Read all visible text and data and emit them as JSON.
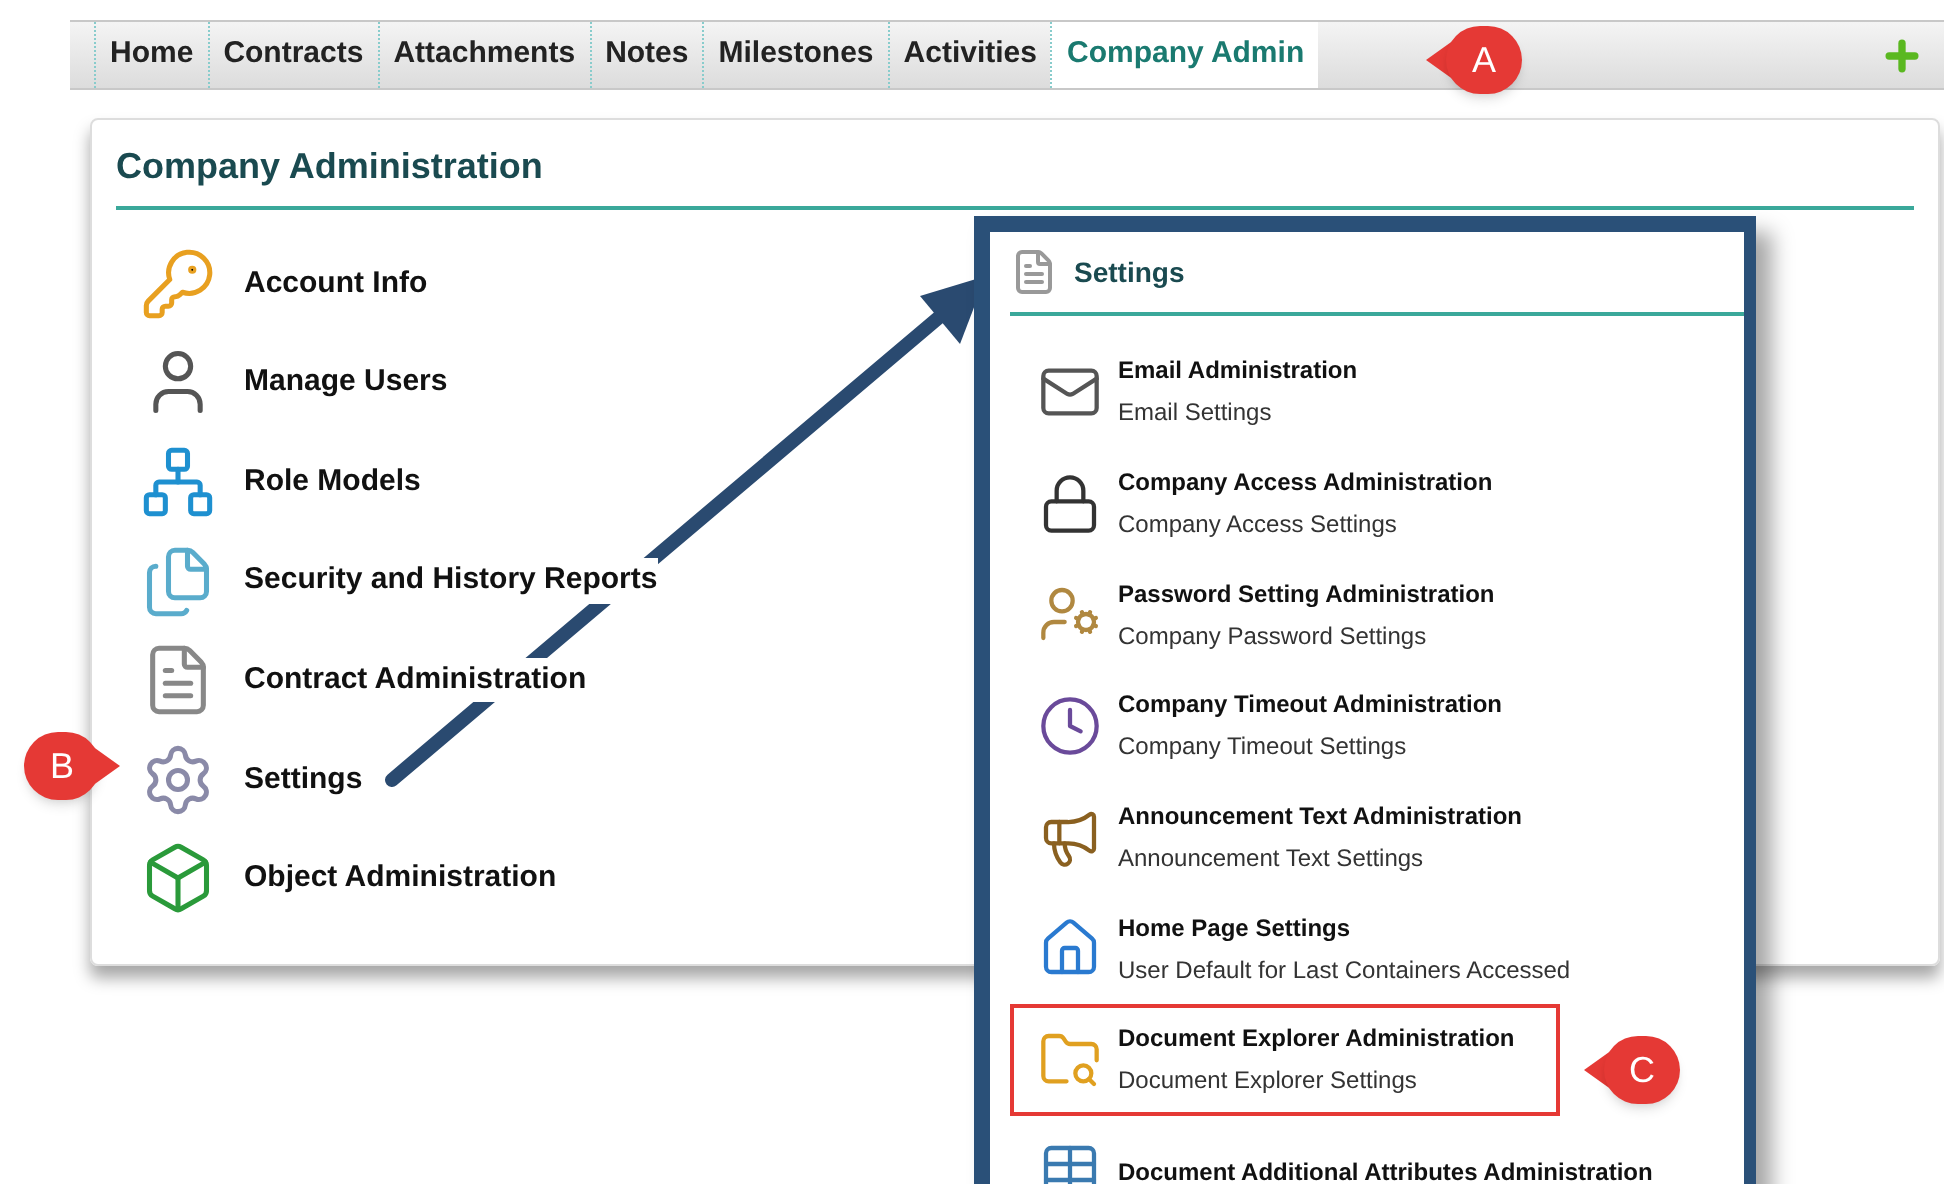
{
  "tabs": [
    {
      "label": "Home",
      "selected": false
    },
    {
      "label": "Contracts",
      "selected": false
    },
    {
      "label": "Attachments",
      "selected": false
    },
    {
      "label": "Notes",
      "selected": false
    },
    {
      "label": "Milestones",
      "selected": false
    },
    {
      "label": "Activities",
      "selected": false
    },
    {
      "label": "Company Admin",
      "selected": true
    }
  ],
  "panel": {
    "title": "Company Administration",
    "items": [
      {
        "label": "Account Info"
      },
      {
        "label": "Manage Users"
      },
      {
        "label": "Role Models"
      },
      {
        "label": "Security and History Reports"
      },
      {
        "label": "Contract Administration"
      },
      {
        "label": "Settings"
      },
      {
        "label": "Object Administration"
      }
    ]
  },
  "settings_popup": {
    "title": "Settings",
    "items": [
      {
        "title": "Email Administration",
        "subtitle": "Email Settings",
        "highlighted": false
      },
      {
        "title": "Company Access Administration",
        "subtitle": "Company Access Settings",
        "highlighted": false
      },
      {
        "title": "Password Setting Administration",
        "subtitle": "Company Password Settings",
        "highlighted": false
      },
      {
        "title": "Company Timeout Administration",
        "subtitle": "Company Timeout Settings",
        "highlighted": false
      },
      {
        "title": "Announcement Text Administration",
        "subtitle": "Announcement Text Settings",
        "highlighted": false
      },
      {
        "title": "Home Page Settings",
        "subtitle": "User Default for Last Containers Accessed",
        "highlighted": false
      },
      {
        "title": "Document Explorer Administration",
        "subtitle": "Document Explorer Settings",
        "highlighted": true
      },
      {
        "title": "Document Additional Attributes Administration",
        "highlighted": false
      }
    ]
  },
  "callouts": [
    {
      "letter": "A"
    },
    {
      "letter": "B"
    },
    {
      "letter": "C"
    }
  ]
}
